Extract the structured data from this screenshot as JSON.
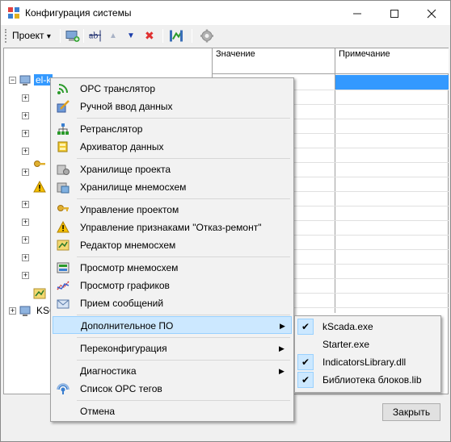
{
  "window": {
    "title": "Конфигурация системы",
    "minimize_icon": "minimize-icon",
    "maximize_icon": "maximize-icon",
    "close_icon": "close-icon"
  },
  "toolbar": {
    "project_label": "Проект",
    "project_arrow": "▾",
    "move_up_arrow": "▲",
    "move_down_arrow": "▼",
    "delete_glyph": "✖"
  },
  "grid": {
    "columns": [
      "Значение",
      "Примечание"
    ]
  },
  "tree": {
    "root_label": "el-k",
    "second_root_label": "KS6"
  },
  "context_menu": {
    "items": [
      {
        "label": "OPC транслятор",
        "icon": "opc-icon"
      },
      {
        "label": "Ручной ввод данных",
        "icon": "manual-input-icon"
      },
      {
        "label": "Ретранслятор",
        "icon": "relay-icon"
      },
      {
        "label": "Архиватор данных",
        "icon": "archiver-icon"
      },
      {
        "label": "Хранилище проекта",
        "icon": "project-storage-icon"
      },
      {
        "label": "Хранилище мнемосхем",
        "icon": "mnemo-storage-icon"
      },
      {
        "label": "Управление проектом",
        "icon": "key-icon"
      },
      {
        "label": "Управление признаками \"Отказ-ремонт\"",
        "icon": "warning-icon"
      },
      {
        "label": "Редактор мнемосхем",
        "icon": "mnemo-editor-icon"
      },
      {
        "label": "Просмотр мнемосхем",
        "icon": "mnemo-view-icon"
      },
      {
        "label": "Просмотр графиков",
        "icon": "graph-icon"
      },
      {
        "label": "Прием сообщений",
        "icon": "messages-icon"
      },
      {
        "label": "Дополнительное ПО",
        "icon": ""
      },
      {
        "label": "Переконфигурация",
        "icon": ""
      },
      {
        "label": "Диагностика",
        "icon": ""
      },
      {
        "label": "Список OPC тегов",
        "icon": "opc-tags-icon"
      },
      {
        "label": "Отмена",
        "icon": ""
      }
    ],
    "submenu_arrow": "▶"
  },
  "submenu": {
    "items": [
      {
        "label": "kScada.exe",
        "checked": true
      },
      {
        "label": "Starter.exe",
        "checked": false
      },
      {
        "label": "IndicatorsLibrary.dll",
        "checked": true
      },
      {
        "label": "Библиотека блоков.lib",
        "checked": true
      }
    ],
    "check_glyph": "✔"
  },
  "footer": {
    "close_label": "Закрыть"
  },
  "colors": {
    "selection": "#3399ff",
    "menu_highlight": "#cce8ff",
    "menu_highlight_border": "#99d1ff"
  }
}
